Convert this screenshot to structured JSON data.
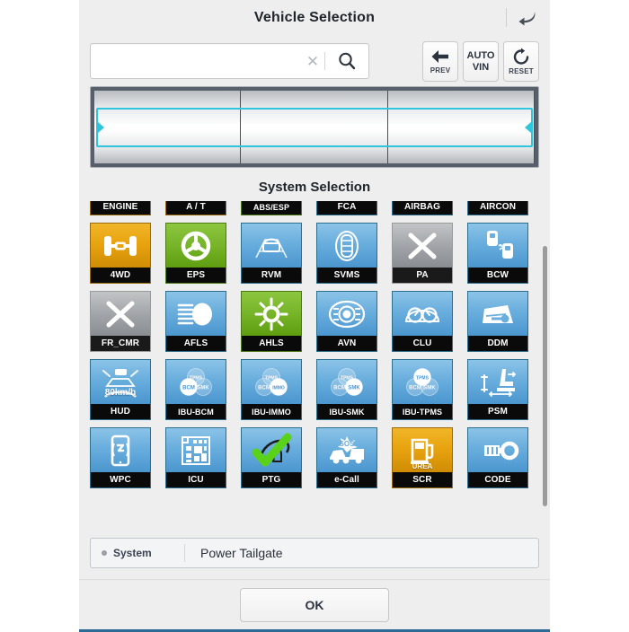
{
  "header": {
    "title": "Vehicle Selection",
    "back_icon": "return-arrow-icon"
  },
  "search": {
    "value": "",
    "placeholder": "",
    "clear_icon": "close-icon",
    "search_icon": "search-icon"
  },
  "toolbar": {
    "buttons": [
      {
        "name": "prev",
        "icon": "arrow-left-icon",
        "caption": "PREV",
        "text": ""
      },
      {
        "name": "auto-vin",
        "icon": "",
        "caption": "",
        "text": "AUTO\nVIN",
        "line1": "AUTO",
        "line2": "VIN"
      },
      {
        "name": "reset",
        "icon": "refresh-icon",
        "caption": "RESET",
        "text": ""
      }
    ]
  },
  "vehicle_picker": {
    "columns": [
      {
        "value": ""
      },
      {
        "value": ""
      },
      {
        "value": ""
      }
    ],
    "highlight_color": "#2fc6dd"
  },
  "system_selection": {
    "title": "System Selection",
    "tiles": [
      {
        "label": "ENGINE",
        "icon": "engine-icon",
        "theme": "orange"
      },
      {
        "label": "A / T",
        "icon": "transmission-icon",
        "theme": "orange"
      },
      {
        "label": "ABS/ESP",
        "icon": "brake-icon",
        "theme": "green"
      },
      {
        "label": "FCA",
        "icon": "fca-icon",
        "theme": "blue"
      },
      {
        "label": "AIRBAG",
        "icon": "airbag-icon",
        "theme": "blue"
      },
      {
        "label": "AIRCON",
        "icon": "aircon-icon",
        "theme": "blue"
      },
      {
        "label": "4WD",
        "icon": "four-wheel-drive-icon",
        "theme": "orange"
      },
      {
        "label": "EPS",
        "icon": "steering-wheel-icon",
        "theme": "green"
      },
      {
        "label": "RVM",
        "icon": "rear-view-monitor-icon",
        "theme": "blue"
      },
      {
        "label": "SVMS",
        "icon": "surround-view-icon",
        "theme": "blue"
      },
      {
        "label": "PA",
        "icon": "x-icon",
        "theme": "gray"
      },
      {
        "label": "BCW",
        "icon": "blind-spot-icon",
        "theme": "blue"
      },
      {
        "label": "FR_CMR",
        "icon": "x-icon",
        "theme": "gray"
      },
      {
        "label": "AFLS",
        "icon": "headlamp-icon",
        "theme": "blue"
      },
      {
        "label": "AHLS",
        "icon": "sun-icon",
        "theme": "green"
      },
      {
        "label": "AVN",
        "icon": "audio-head-unit-icon",
        "theme": "blue"
      },
      {
        "label": "CLU",
        "icon": "cluster-icon",
        "theme": "blue"
      },
      {
        "label": "DDM",
        "icon": "door-key-icon",
        "theme": "blue"
      },
      {
        "label": "HUD",
        "icon": "head-up-display-icon",
        "theme": "blue",
        "inner_text": "80km/h"
      },
      {
        "label": "IBU-BCM",
        "icon": "ibu-bcm-icon",
        "theme": "blue"
      },
      {
        "label": "IBU-IMMO",
        "icon": "ibu-immo-icon",
        "theme": "blue"
      },
      {
        "label": "IBU-SMK",
        "icon": "ibu-smk-icon",
        "theme": "blue"
      },
      {
        "label": "IBU-TPMS",
        "icon": "ibu-tpms-icon",
        "theme": "blue"
      },
      {
        "label": "PSM",
        "icon": "power-seat-icon",
        "theme": "blue"
      },
      {
        "label": "WPC",
        "icon": "wireless-charger-icon",
        "theme": "blue"
      },
      {
        "label": "ICU",
        "icon": "integrated-control-unit-icon",
        "theme": "blue"
      },
      {
        "label": "PTG",
        "icon": "power-tailgate-icon",
        "theme": "blue"
      },
      {
        "label": "e-Call",
        "icon": "ecall-crash-icon",
        "theme": "blue"
      },
      {
        "label": "SCR",
        "icon": "urea-pump-icon",
        "theme": "orange",
        "inner_text": "UREA"
      },
      {
        "label": "CODE",
        "icon": "code-key-icon",
        "theme": "blue"
      }
    ],
    "ibu_labels": {
      "tpms": "TPMS",
      "bcm": "BCM",
      "smk": "SMK",
      "immo": "IMMO"
    },
    "ecall_text": "SOS"
  },
  "summary": {
    "key": "System",
    "value": "Power Tailgate"
  },
  "footer": {
    "ok_label": "OK"
  }
}
